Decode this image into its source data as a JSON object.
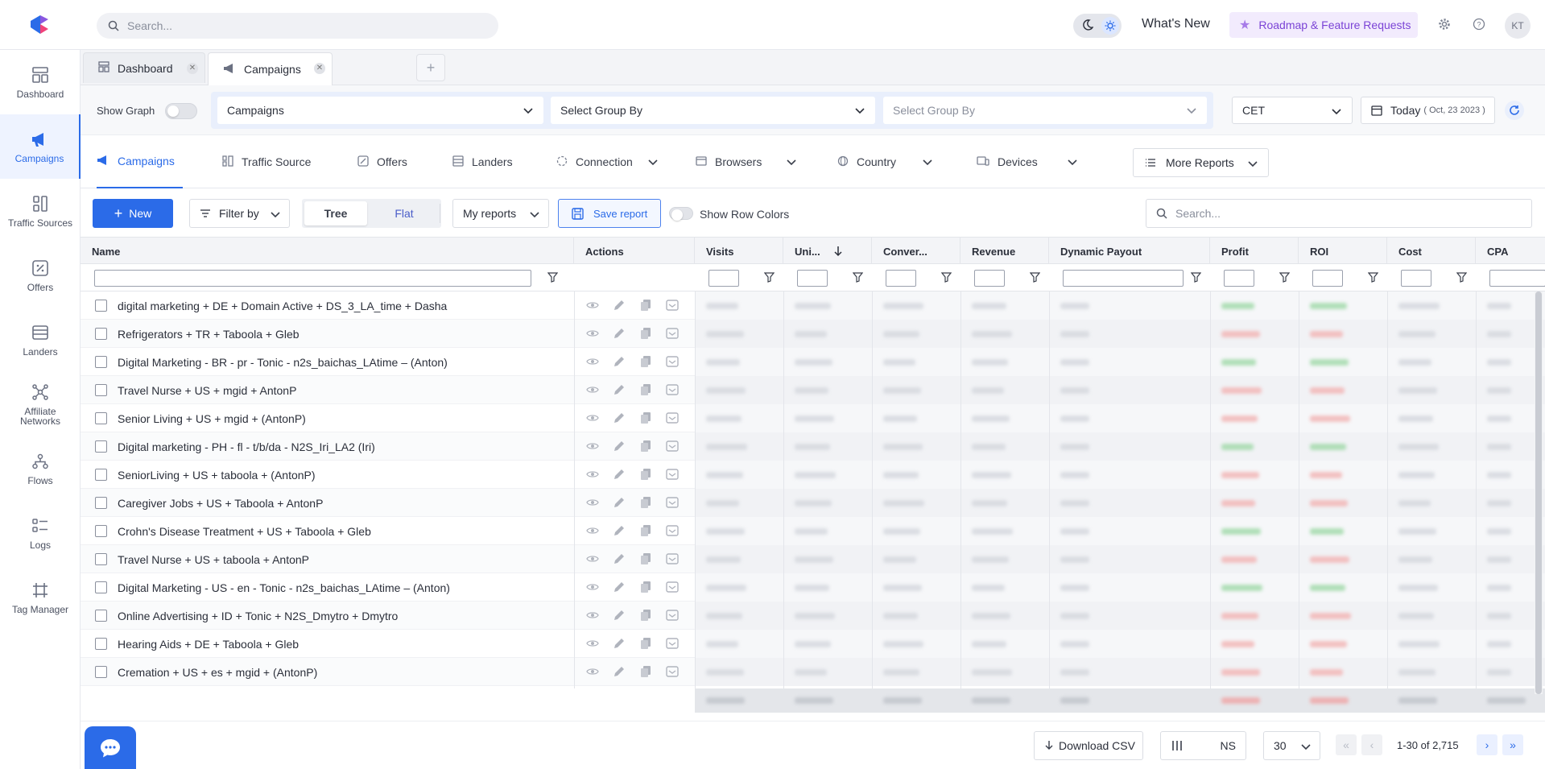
{
  "topbar": {
    "search_placeholder": "Search...",
    "whats_new": "What's New",
    "roadmap": "Roadmap & Feature Requests",
    "avatar_initials": "KT"
  },
  "sidebar": {
    "items": [
      {
        "label": "Dashboard",
        "icon": "dashboard-icon"
      },
      {
        "label": "Campaigns",
        "icon": "megaphone-icon",
        "active": true
      },
      {
        "label": "Traffic Sources",
        "icon": "traffic-sources-icon"
      },
      {
        "label": "Offers",
        "icon": "offers-icon"
      },
      {
        "label": "Landers",
        "icon": "landers-icon"
      },
      {
        "label": "Affiliate Networks",
        "icon": "affiliate-networks-icon"
      },
      {
        "label": "Flows",
        "icon": "flows-icon"
      },
      {
        "label": "Logs",
        "icon": "logs-icon"
      },
      {
        "label": "Tag Manager",
        "icon": "tag-manager-icon"
      }
    ]
  },
  "tabs": [
    {
      "label": "Dashboard"
    },
    {
      "label": "Campaigns",
      "active": true
    }
  ],
  "filters": {
    "show_graph": "Show Graph",
    "group1": "Campaigns",
    "group2": "Select Group By",
    "group3": "Select Group By",
    "timezone": "CET",
    "date_label": "Today",
    "date_detail": "( Oct, 23 2023 )"
  },
  "report_tabs": [
    {
      "label": "Campaigns",
      "active": true
    },
    {
      "label": "Traffic Source"
    },
    {
      "label": "Offers"
    },
    {
      "label": "Landers"
    },
    {
      "label": "Connection",
      "dropdown": true
    },
    {
      "label": "Browsers",
      "dropdown": true
    },
    {
      "label": "Country",
      "dropdown": true
    },
    {
      "label": "Devices",
      "dropdown": true
    }
  ],
  "more_reports": "More Reports",
  "toolbar": {
    "new": "New",
    "filter_by": "Filter by",
    "tree": "Tree",
    "flat": "Flat",
    "my_reports": "My reports",
    "save_report": "Save report",
    "show_row_colors": "Show Row Colors",
    "search_placeholder": "Search..."
  },
  "columns": [
    "Name",
    "Actions",
    "Visits",
    "Uni...",
    "Conver...",
    "Revenue",
    "Dynamic Payout",
    "Profit",
    "ROI",
    "Cost",
    "CPA"
  ],
  "rows": [
    {
      "name": "digital marketing + DE + Domain Active + DS_3_LA_time + Dasha",
      "trend": "up"
    },
    {
      "name": "Refrigerators + TR + Taboola + Gleb",
      "trend": "down"
    },
    {
      "name": "Digital Marketing - BR - pr - Tonic - n2s_baichas_LAtime – (Anton)",
      "trend": "up"
    },
    {
      "name": "Travel Nurse + US + mgid + AntonP",
      "trend": "down"
    },
    {
      "name": "Senior Living + US + mgid + (AntonP)",
      "trend": "down"
    },
    {
      "name": "Digital marketing - PH - fl - t/b/da - N2S_Iri_LA2 (Iri)",
      "trend": "up"
    },
    {
      "name": "SeniorLiving + US + taboola + (AntonP)",
      "trend": "down"
    },
    {
      "name": "Caregiver Jobs + US + Taboola + AntonP",
      "trend": "down"
    },
    {
      "name": "Crohn's Disease Treatment + US + Taboola + Gleb",
      "trend": "up"
    },
    {
      "name": "Travel Nurse + US + taboola + AntonP",
      "trend": "down"
    },
    {
      "name": "Digital Marketing - US - en - Tonic - n2s_baichas_LAtime – (Anton)",
      "trend": "up"
    },
    {
      "name": "Online Advertising + ID + Tonic + N2S_Dmytro + Dmytro",
      "trend": "down"
    },
    {
      "name": "Hearing Aids + DE + Taboola + Gleb",
      "trend": "down"
    },
    {
      "name": "Cremation + US + es + mgid + (AntonP)",
      "trend": "down"
    }
  ],
  "bottom": {
    "download_csv": "Download CSV",
    "ns": "NS",
    "per_page": "30",
    "page_info": "1-30 of 2,715"
  },
  "colors": {
    "accent": "#2b6be8",
    "roadmap_bg": "#f2ebfd",
    "roadmap_text": "#7b43d6"
  }
}
